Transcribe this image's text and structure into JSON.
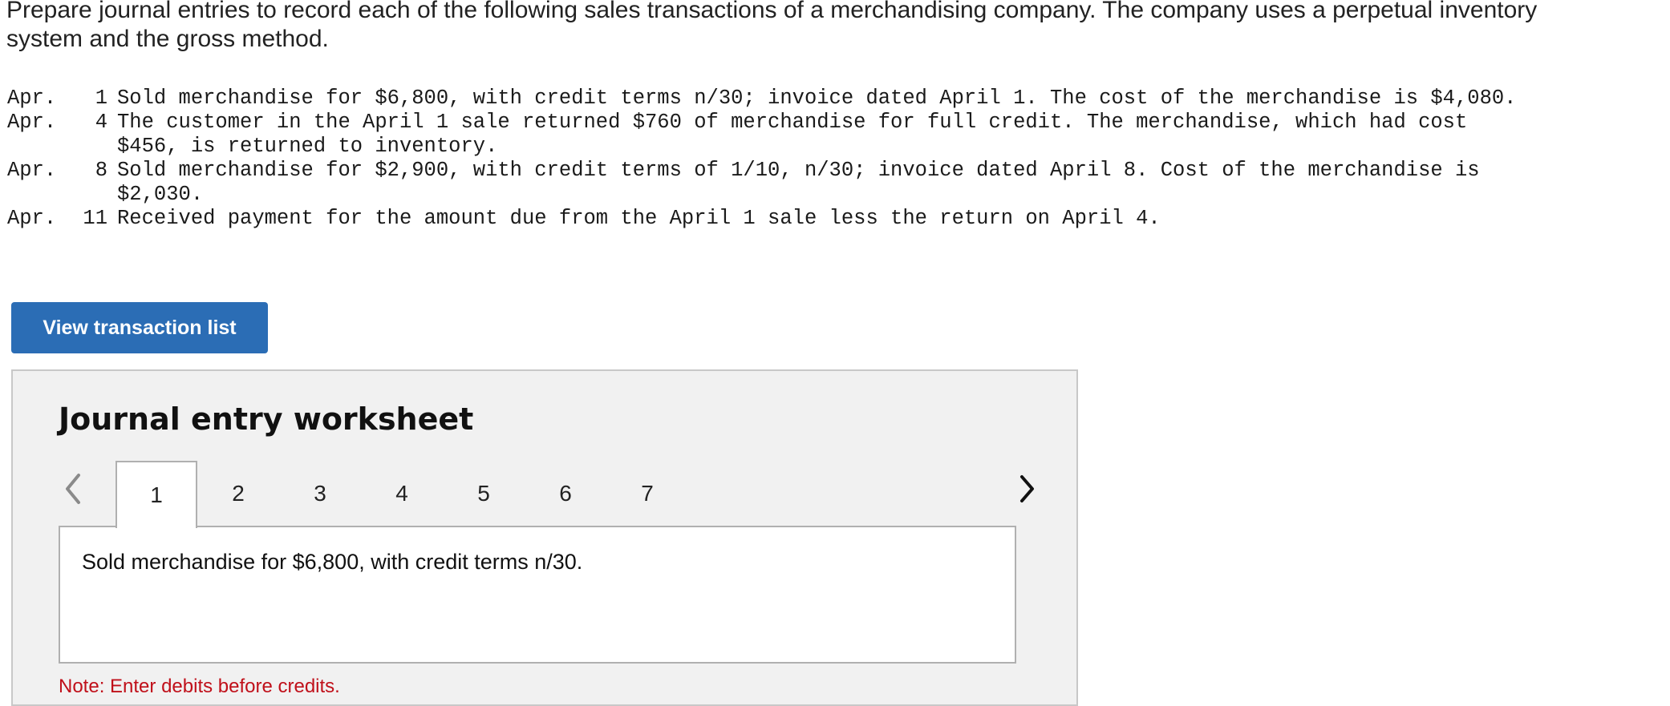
{
  "intro": "Prepare journal entries to record each of the following sales transactions of a merchandising company. The company uses a perpetual inventory system and the gross method.",
  "transactions": [
    {
      "month": "Apr.",
      "day": "1",
      "text": "Sold merchandise for $6,800, with credit terms n/30; invoice dated April 1. The cost of the merchandise is $4,080."
    },
    {
      "month": "Apr.",
      "day": "4",
      "text": "The customer in the April 1 sale returned $760 of merchandise for full credit. The merchandise, which had cost $456, is returned to inventory."
    },
    {
      "month": "Apr.",
      "day": "8",
      "text": "Sold merchandise for $2,900, with credit terms of 1/10, n/30; invoice dated April 8. Cost of the merchandise is $2,030."
    },
    {
      "month": "Apr.",
      "day": "11",
      "text": "Received payment for the amount due from the April 1 sale less the return on April 4."
    }
  ],
  "view_button": "View transaction list",
  "worksheet": {
    "title": "Journal entry worksheet",
    "tabs": [
      "1",
      "2",
      "3",
      "4",
      "5",
      "6",
      "7"
    ],
    "active_tab": "1",
    "description": "Sold merchandise for $6,800, with credit terms n/30.",
    "note": "Note: Enter debits before credits."
  },
  "icons": {
    "prev": "chevron-left-icon",
    "next": "chevron-right-icon"
  },
  "colors": {
    "button": "#2b6db5",
    "note": "#c0101a",
    "worksheet_bg": "#f1f1f1"
  }
}
